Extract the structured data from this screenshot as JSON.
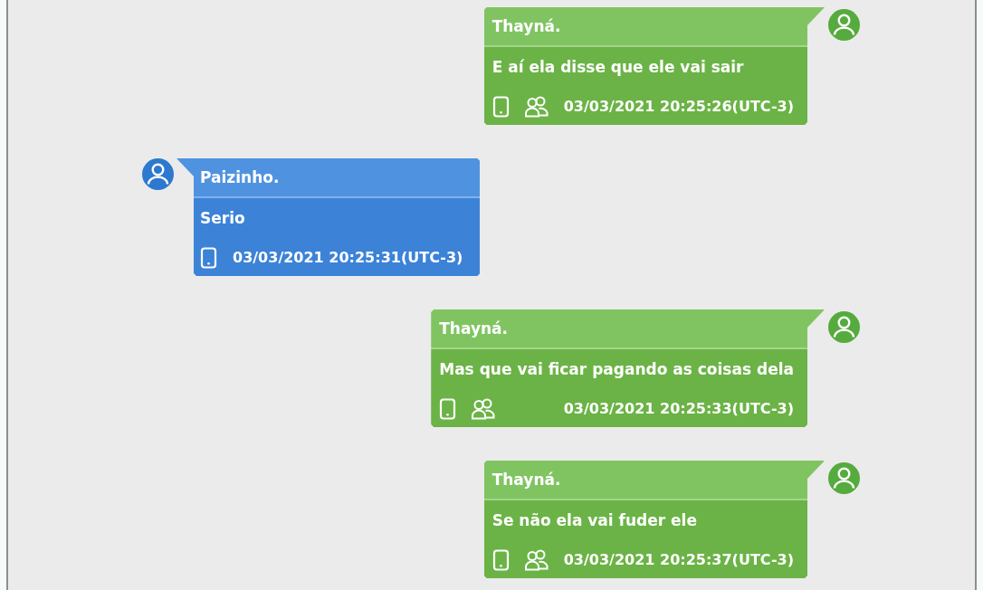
{
  "messages": [
    {
      "kind": "sent",
      "sender": "Thayná.",
      "text": "E aí ela disse que ele vai sair",
      "timestamp": "03/03/2021 20:25:26(UTC-3)"
    },
    {
      "kind": "received",
      "sender": "Paizinho.",
      "text": "Serio",
      "timestamp": "03/03/2021 20:25:31(UTC-3)"
    },
    {
      "kind": "sent",
      "sender": "Thayná.",
      "text": "Mas que vai ficar pagando as coisas dela",
      "timestamp": "03/03/2021 20:25:33(UTC-3)"
    },
    {
      "kind": "sent",
      "sender": "Thayná.",
      "text": "Se não ela vai fuder ele",
      "timestamp": "03/03/2021 20:25:37(UTC-3)"
    }
  ]
}
